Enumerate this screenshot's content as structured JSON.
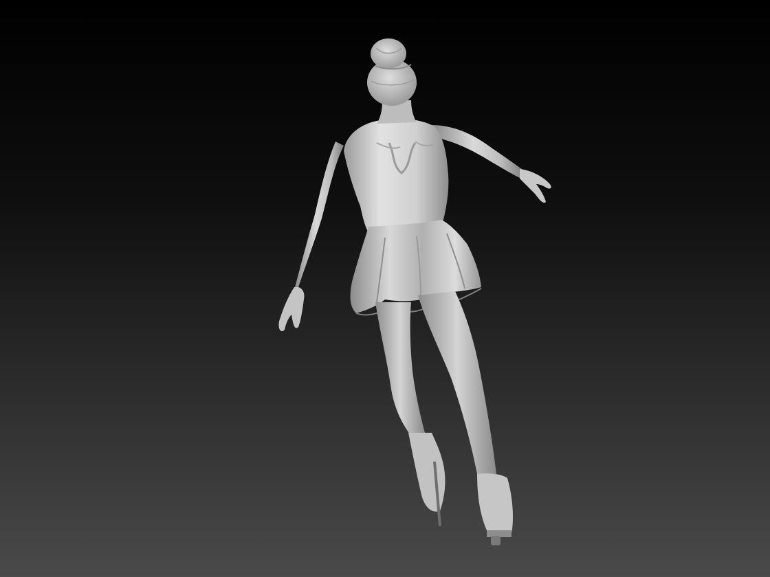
{
  "scene": {
    "subject": "figure-skater-sculpt",
    "background_top": "#000000",
    "background_bottom": "#4a4a4a",
    "material_light": "#e6e6e6",
    "material_mid": "#a9a9a9",
    "material_dark": "#5e5e5e"
  }
}
